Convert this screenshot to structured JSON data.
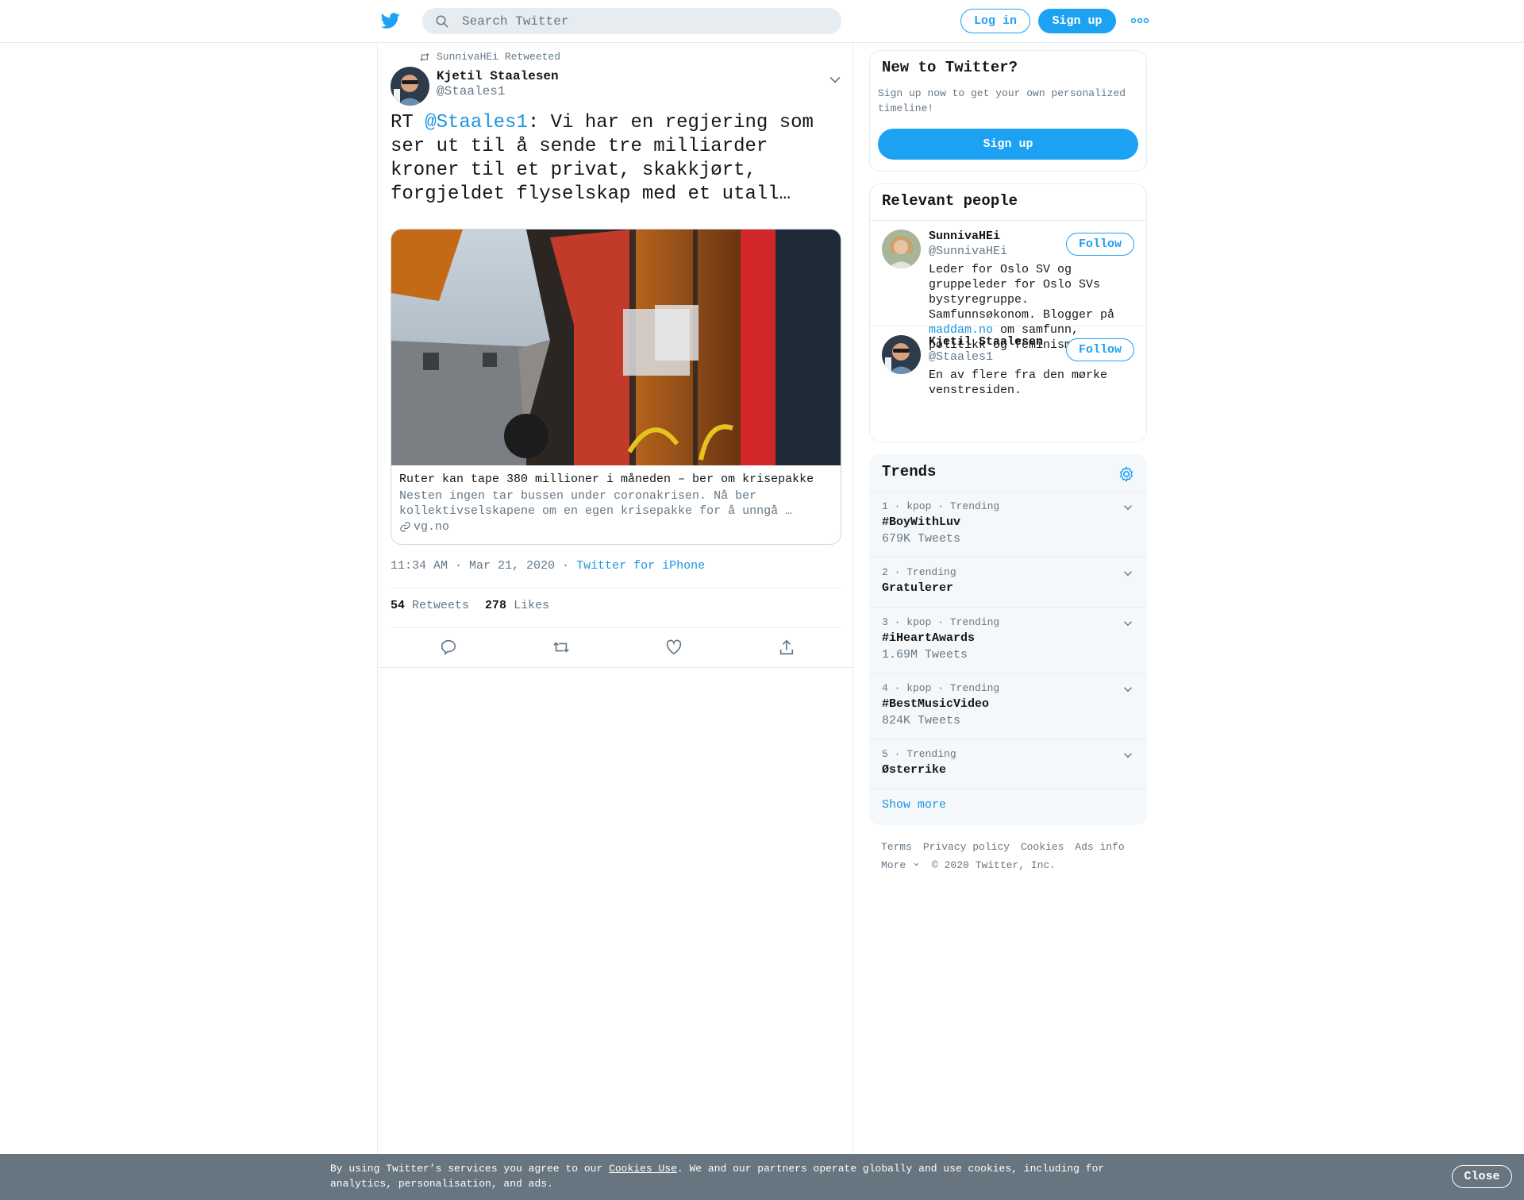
{
  "header": {
    "search_placeholder": "Search Twitter",
    "login_label": "Log in",
    "signup_label": "Sign up",
    "icons": [
      "twitter-bird-icon",
      "search-icon",
      "more-dots-icon"
    ]
  },
  "tweet": {
    "retweeted_by": "SunnivaHEi Retweeted",
    "author_name": "Kjetil Staalesen",
    "author_handle": "@Staales1",
    "text_prefix": "RT ",
    "mention": "@Staales1",
    "text_body": ": Vi har en regjering som ser ut til å sende tre milliarder kroner til et privat, skakkjørt, forgjeldet flyselskap med et utall…",
    "card": {
      "title": "Ruter kan tape 380 millioner i måneden – ber om krisepakke",
      "description": "Nesten ingen tar bussen under coronakrisen. Nå ber kollektivselskapene om en egen krisepakke for å unngå …",
      "domain": "vg.no"
    },
    "timestamp": "11:34 AM · Mar 21, 2020",
    "separator": " · ",
    "source": "Twitter for iPhone",
    "retweets_count": "54",
    "retweets_label": "Retweets",
    "likes_count": "278",
    "likes_label": "Likes",
    "action_icons": [
      "reply-icon",
      "retweet-icon",
      "like-icon",
      "share-icon"
    ]
  },
  "sidebar": {
    "new_to_twitter": {
      "title": "New to Twitter?",
      "subtitle": "Sign up now to get your own personalized timeline!",
      "button": "Sign up"
    },
    "relevant_people": {
      "title": "Relevant people",
      "people": [
        {
          "name": "SunnivaHEi",
          "handle": "@SunnivaHEi",
          "bio_before": "Leder for Oslo SV og gruppeleder for Oslo SVs bystyregruppe. Samfunnsøkonom. Blogger på ",
          "bio_link": "maddam.no",
          "bio_after": " om samfunn, politikk og feminisme.",
          "follow": "Follow"
        },
        {
          "name": "Kjetil Staalesen",
          "handle": "@Staales1",
          "bio": "En av flere fra den mørke venstresiden.",
          "follow": "Follow"
        }
      ]
    },
    "trends": {
      "title": "Trends",
      "items": [
        {
          "meta": "1 · kpop · Trending",
          "name": "#BoyWithLuv",
          "count": "679K Tweets"
        },
        {
          "meta": "2 · Trending",
          "name": "Gratulerer",
          "count": ""
        },
        {
          "meta": "3 · kpop · Trending",
          "name": "#iHeartAwards",
          "count": "1.69M Tweets"
        },
        {
          "meta": "4 · kpop · Trending",
          "name": "#BestMusicVideo",
          "count": "824K Tweets"
        },
        {
          "meta": "5 · Trending",
          "name": "Østerrike",
          "count": ""
        }
      ],
      "show_more": "Show more"
    },
    "footer": {
      "links": [
        "Terms",
        "Privacy policy",
        "Cookies",
        "Ads info"
      ],
      "more": "More",
      "copyright": "© 2020 Twitter, Inc."
    }
  },
  "cookie_banner": {
    "text_before": "By using Twitter’s services you agree to our ",
    "link": "Cookies Use",
    "text_after": ". We and our partners operate globally and use cookies, including for analytics, personalisation, and ads.",
    "close": "Close"
  },
  "colors": {
    "accent": "#1da1f2",
    "link": "#1b95e0",
    "muted": "#657786",
    "border": "#e6ecf0",
    "trends_bg": "#f5f8fa",
    "cookie_bg": "#66757f"
  }
}
